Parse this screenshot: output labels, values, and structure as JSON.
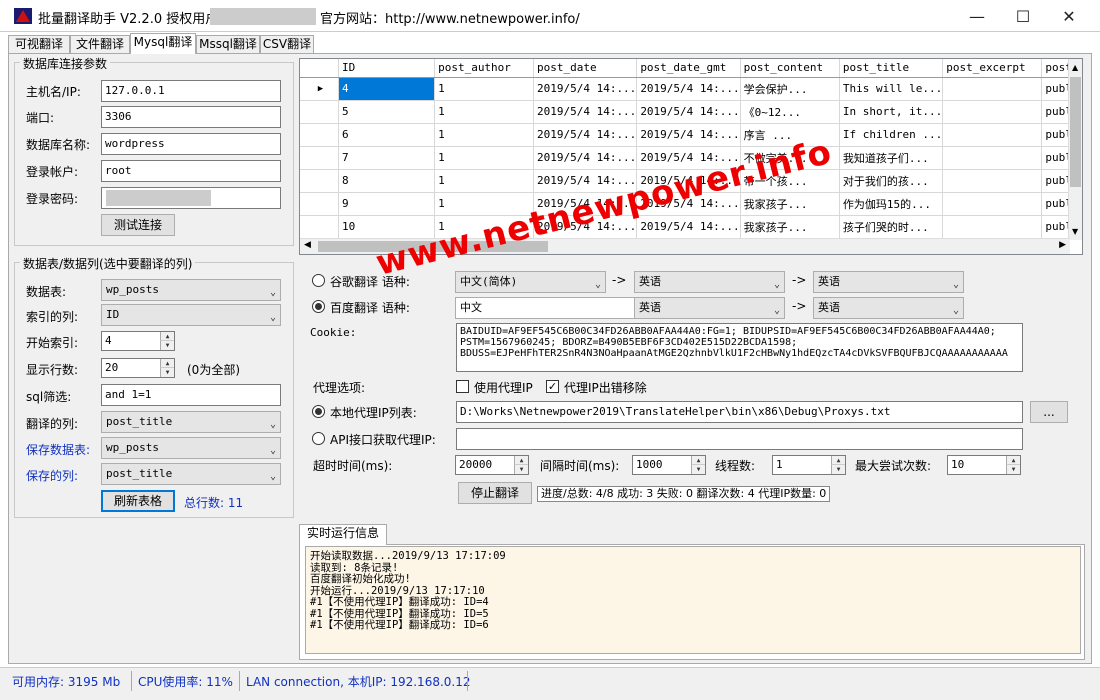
{
  "window": {
    "title": "批量翻译助手 V2.2.0 授权用户：",
    "site_label": "官方网站：http://www.netnewpower.info/"
  },
  "tabs": [
    "可视翻译",
    "文件翻译",
    "Mysql翻译",
    "Mssql翻译",
    "CSV翻译"
  ],
  "db": {
    "group_title": "数据库连接参数",
    "host_label": "主机名/IP:",
    "host": "127.0.0.1",
    "port_label": "端口:",
    "port": "3306",
    "dbname_label": "数据库名称:",
    "dbname": "wordpress",
    "user_label": "登录帐户:",
    "user": "root",
    "password_label": "登录密码:",
    "test_button": "测试连接"
  },
  "table_sel": {
    "group_title": "数据表/数据列(选中要翻译的列)",
    "table_label": "数据表:",
    "table": "wp_posts",
    "index_col_label": "索引的列:",
    "index_col": "ID",
    "start_label": "开始索引:",
    "start": "4",
    "rows_label": "显示行数:",
    "rows": "20",
    "rows_hint": "(0为全部)",
    "sql_label": "sql筛选:",
    "sql": "and 1=1",
    "trans_col_label": "翻译的列:",
    "trans_col": "post_title",
    "save_table_label": "保存数据表:",
    "save_table": "wp_posts",
    "save_col_label": "保存的列:",
    "save_col": "post_title",
    "refresh_button": "刷新表格",
    "total": "总行数: 11"
  },
  "grid": {
    "columns": [
      "ID",
      "post_author",
      "post_date",
      "post_date_gmt",
      "post_content",
      "post_title",
      "post_excerpt",
      "post"
    ],
    "rows": [
      [
        "4",
        "1",
        "2019/5/4 14:...",
        "2019/5/4 14:...",
        "  学会保护...",
        "This will le...",
        "",
        "publ"
      ],
      [
        "5",
        "1",
        "2019/5/4 14:...",
        "2019/5/4 14:...",
        "  《0~12...",
        "In short, it...",
        "",
        "publ"
      ],
      [
        "6",
        "1",
        "2019/5/4 14:...",
        "2019/5/4 14:...",
        "  序言    ...",
        "If children ...",
        "",
        "publ"
      ],
      [
        "7",
        "1",
        "2019/5/4 14:...",
        "2019/5/4 14:...",
        "  不做完美...",
        "我知道孩子们...",
        "",
        "publ"
      ],
      [
        "8",
        "1",
        "2019/5/4 14:...",
        "2019/5/4 14:...",
        "  带一个孩...",
        "对于我们的孩...",
        "",
        "publ"
      ],
      [
        "9",
        "1",
        "2019/5/4 14:...",
        "2019/5/4 14:...",
        "  我家孩子...",
        "作为伽玛15的...",
        "",
        "publ"
      ],
      [
        "10",
        "1",
        "2019/5/4 14:...",
        "2019/5/4 14:...",
        "  我家孩子...",
        "孩子们哭的时...",
        "",
        "publ"
      ]
    ]
  },
  "translate": {
    "google_label": "谷歌翻译  语种:",
    "baidu_label": "百度翻译  语种:",
    "google_from": "中文(简体)",
    "google_mid": "英语",
    "google_to": "英语",
    "baidu_from": "中文",
    "baidu_mid": "英语",
    "baidu_to": "英语",
    "arrow": "->",
    "cookie_label": "Cookie:",
    "cookie": "BAIDUID=AF9EF545C6B00C34FD26ABB0AFAA44A0:FG=1; BIDUPSID=AF9EF545C6B00C34FD26ABB0AFAA44A0;\nPSTM=1567960245; BDORZ=B490B5EBF6F3CD402E515D22BCDA1598;\nBDUSS=EJPeHFhTER2SnR4N3NOaHpaanAtMGE2QzhnbVlkU1F2cHBwNy1hdEQzcTA4cDVkSVFBQUFBJCQAAAAAAAAAAA",
    "proxy_label": "代理选项:",
    "use_proxy": "使用代理IP",
    "proxy_remove": "代理IP出错移除",
    "local_proxy_label": "本地代理IP列表:",
    "local_proxy_path": "D:\\Works\\Netnewpower2019\\TranslateHelper\\bin\\x86\\Debug\\Proxys.txt",
    "browse": "...",
    "api_proxy_label": "API接口获取代理IP:",
    "timeout_label": "超时时间(ms):",
    "timeout": "20000",
    "interval_label": "间隔时间(ms):",
    "interval": "1000",
    "threads_label": "线程数:",
    "threads": "1",
    "retries_label": "最大尝试次数:",
    "retries": "10",
    "stop_button": "停止翻译",
    "progress": "进度/总数: 4/8 成功: 3 失败: 0 翻译次数: 4 代理IP数量: 0"
  },
  "log": {
    "tab": "实时运行信息",
    "lines": [
      "开始读取数据...2019/9/13 17:17:09",
      "读取到: 8条记录!",
      "百度翻译初始化成功!",
      "开始运行...2019/9/13 17:17:10",
      "#1【不使用代理IP】翻译成功: ID=4",
      "#1【不使用代理IP】翻译成功: ID=5",
      "#1【不使用代理IP】翻译成功: ID=6"
    ]
  },
  "status": {
    "memory": "可用内存: 3195 Mb",
    "cpu": "CPU使用率: 11%",
    "network": "LAN connection, 本机IP: 192.168.0.12"
  },
  "watermark": "www.netnewpower.info",
  "colors": {
    "accent": "#0078d7",
    "label_blue": "#1030c0",
    "log_bg": "#fdf6e7",
    "watermark": "#ee0000"
  }
}
